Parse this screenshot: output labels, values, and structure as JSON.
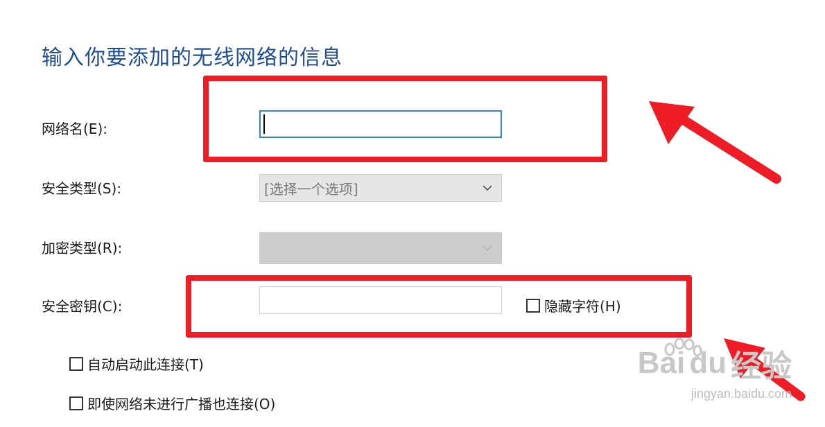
{
  "dialog": {
    "heading": "输入你要添加的无线网络的信息"
  },
  "fields": {
    "network_name": {
      "label": "网络名(E):",
      "value": ""
    },
    "security_type": {
      "label": "安全类型(S):",
      "selected": "[选择一个选项]"
    },
    "encryption_type": {
      "label": "加密类型(R):",
      "selected": ""
    },
    "security_key": {
      "label": "安全密钥(C):",
      "value": "",
      "hide_chars_label": "隐藏字符(H)"
    }
  },
  "options": {
    "auto_connect_label": "自动启动此连接(T)",
    "connect_hidden_label": "即使网络未进行广播也连接(O)"
  },
  "watermark": {
    "brand": "Bai",
    "brand_du": "du",
    "brand_cn": "经验",
    "url": "jingyan.baidu.com"
  },
  "colors": {
    "heading": "#1f4e96",
    "annotation_red": "#ee1c24",
    "input_focus": "#2f86c8"
  },
  "icons": {
    "select_arrow": "chevron-down-icon",
    "annotation": "red-arrow-icon"
  }
}
